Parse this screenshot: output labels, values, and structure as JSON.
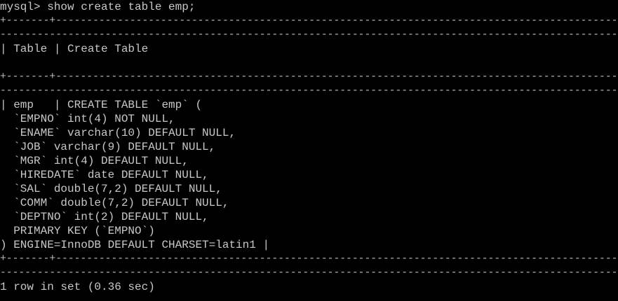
{
  "terminal": {
    "background": "#000000",
    "foreground": "#c8c8c8",
    "prompt": "mysql> ",
    "command": "show create table emp;",
    "border_top": "+-------+------------------------------------------------------------------------------------------------------",
    "border_top_cont": "--------------------------------------------------------------------------------------------------------------",
    "header_row": "| Table | Create Table",
    "blank": "",
    "border_mid": "+-------+------------------------------------------------------------------------------------------------------",
    "border_mid_cont": "--------------------------------------------------------------------------------------------------------------",
    "data_lines": [
      "| emp   | CREATE TABLE `emp` (",
      "  `EMPNO` int(4) NOT NULL,",
      "  `ENAME` varchar(10) DEFAULT NULL,",
      "  `JOB` varchar(9) DEFAULT NULL,",
      "  `MGR` int(4) DEFAULT NULL,",
      "  `HIREDATE` date DEFAULT NULL,",
      "  `SAL` double(7,2) DEFAULT NULL,",
      "  `COMM` double(7,2) DEFAULT NULL,",
      "  `DEPTNO` int(2) DEFAULT NULL,",
      "  PRIMARY KEY (`EMPNO`)",
      ") ENGINE=InnoDB DEFAULT CHARSET=latin1 |"
    ],
    "border_bottom": "+-------+------------------------------------------------------------------------------------------------------",
    "border_bottom_cont": "--------------------------------------------------------------------------------------------------------------",
    "result_summary": "1 row in set (0.36 sec)"
  }
}
